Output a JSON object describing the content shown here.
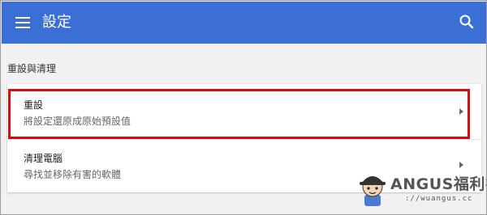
{
  "app_bar": {
    "title": "設定",
    "menu_icon": "hamburger-menu-icon",
    "search_icon": "search-icon",
    "color": "#3b6fd6"
  },
  "section": {
    "title": "重設與清理"
  },
  "items": [
    {
      "title": "重設",
      "subtitle": "將設定還原成原始預設值",
      "highlighted": true
    },
    {
      "title": "清理電腦",
      "subtitle": "尋找並移除有害的軟體",
      "highlighted": false
    }
  ],
  "highlight_color": "#cc1111",
  "watermark": {
    "logo": "ANGUS福利社",
    "url": "://wuangus.cc"
  }
}
